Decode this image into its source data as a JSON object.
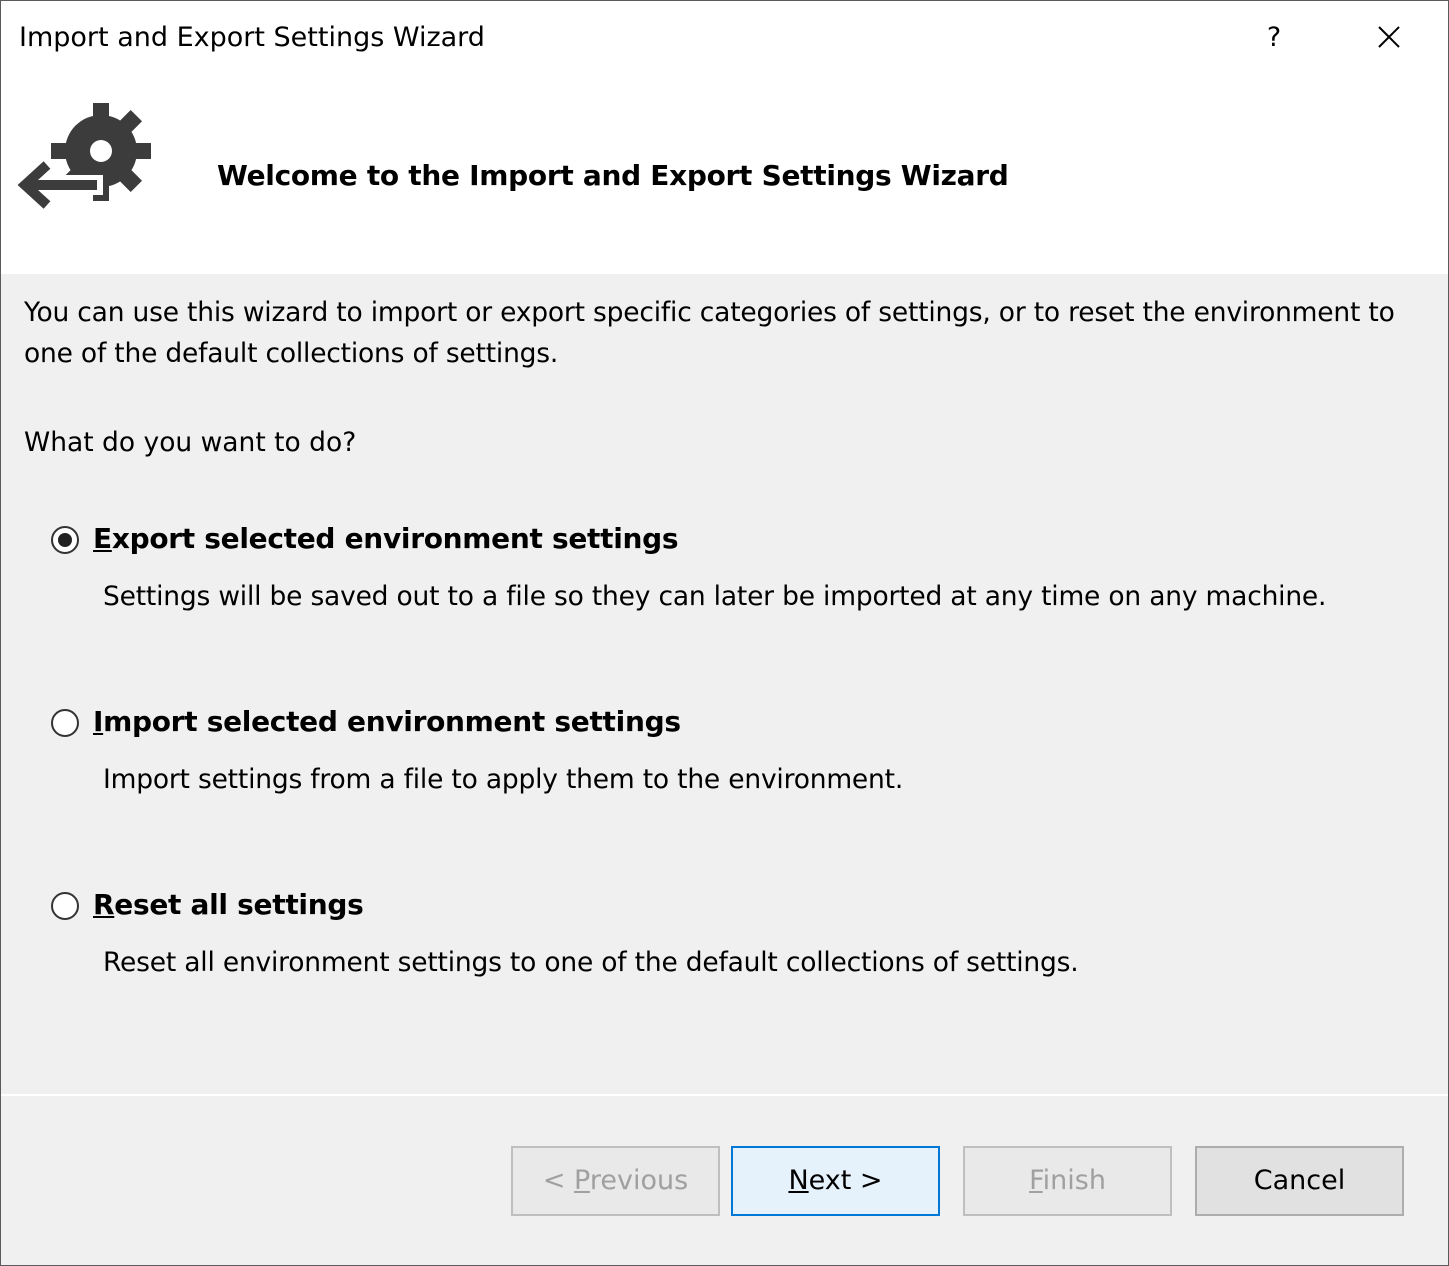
{
  "window": {
    "title": "Import and Export Settings Wizard",
    "help_glyph": "?",
    "close_icon": "close-icon"
  },
  "header": {
    "icon": "settings-gear-arrow-icon",
    "title": "Welcome to the Import and Export Settings Wizard"
  },
  "intro": {
    "text": "You can use this wizard to import or export specific categories of settings, or to reset the environment to one of the default collections of settings.",
    "question": "What do you want to do?"
  },
  "options": [
    {
      "mnemonic": "E",
      "label_rest": "xport selected environment settings",
      "label": "Export selected environment settings",
      "description": "Settings will be saved out to a file so they can later be imported at any time on any machine.",
      "selected": true
    },
    {
      "mnemonic": "I",
      "label_rest": "mport selected environment settings",
      "label": "Import selected environment settings",
      "description": "Import settings from a file to apply them to the environment.",
      "selected": false
    },
    {
      "mnemonic": "R",
      "label_rest": "eset all settings",
      "label": "Reset all settings",
      "description": "Reset all environment settings to one of the default collections of settings.",
      "selected": false
    }
  ],
  "buttons": {
    "previous": {
      "prefix": "< ",
      "mnemonic": "P",
      "rest": "revious",
      "enabled": false
    },
    "next": {
      "mnemonic": "N",
      "rest": "ext >",
      "enabled": true,
      "default": true
    },
    "finish": {
      "mnemonic": "F",
      "rest": "inish",
      "enabled": false
    },
    "cancel": {
      "label": "Cancel",
      "enabled": true
    }
  },
  "colors": {
    "dialog_background": "#f0f0f0",
    "header_background": "#ffffff",
    "default_button_border": "#0078d7",
    "disabled_text": "#a0a0a0",
    "icon_color": "#3c3c3c"
  }
}
